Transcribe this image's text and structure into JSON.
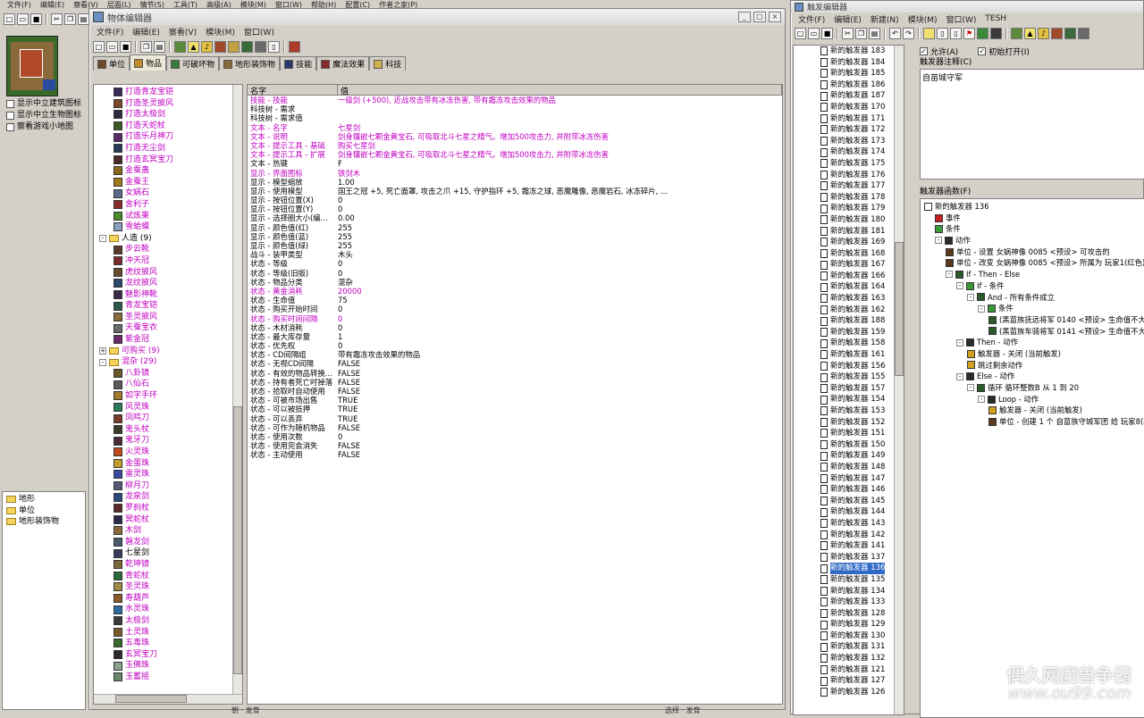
{
  "main_menu": [
    "文件(F)",
    "编辑(E)",
    "察看(V)",
    "层面(L)",
    "情节(S)",
    "工具(T)",
    "高级(A)",
    "模块(M)",
    "窗口(W)",
    "帮助(H)",
    "配置(C)",
    "作者之家(P)"
  ],
  "minimap_options": [
    "显示中立建筑图标",
    "显示中立生物图标",
    "察看游戏小地图"
  ],
  "palette_tree": [
    "地形",
    "单位",
    "地形装饰物"
  ],
  "object_editor": {
    "title": "物体编辑器",
    "menu": [
      "文件(F)",
      "编辑(E)",
      "察看(V)",
      "模块(M)",
      "窗口(W)"
    ],
    "tabs": [
      {
        "label": "单位",
        "icon": "unit-icon"
      },
      {
        "label": "物品",
        "icon": "item-icon"
      },
      {
        "label": "可破坏物",
        "icon": "destructible-icon"
      },
      {
        "label": "地形装饰物",
        "icon": "doodad-icon"
      },
      {
        "label": "技能",
        "icon": "ability-icon"
      },
      {
        "label": "魔法效果",
        "icon": "buff-icon"
      },
      {
        "label": "科技",
        "icon": "upgrade-icon"
      }
    ],
    "tree_rows": [
      {
        "t": "item",
        "label": "打造青龙宝铠",
        "color": "mag",
        "ic": "#3a2a5a"
      },
      {
        "t": "item",
        "label": "打造圣灵披风",
        "color": "mag",
        "ic": "#7a4a2a"
      },
      {
        "t": "item",
        "label": "打造太极剑",
        "color": "mag",
        "ic": "#2a2a3a"
      },
      {
        "t": "item",
        "label": "打造天蛇杖",
        "color": "mag",
        "ic": "#3a5a2a"
      },
      {
        "t": "item",
        "label": "打造乐月神刀",
        "color": "mag",
        "ic": "#5a2a6a"
      },
      {
        "t": "item",
        "label": "打造无尘剑",
        "color": "mag",
        "ic": "#2a3a5a"
      },
      {
        "t": "item",
        "label": "打造玄冥宝刀",
        "color": "mag",
        "ic": "#4a2a2a"
      },
      {
        "t": "item",
        "label": "金蚕蛊",
        "color": "mag",
        "ic": "#8a6a1a"
      },
      {
        "t": "item",
        "label": "金蚕王",
        "color": "mag",
        "ic": "#a07a1a"
      },
      {
        "t": "item",
        "label": "女娲石",
        "color": "mag",
        "ic": "#5a6a8a"
      },
      {
        "t": "item",
        "label": "舍利子",
        "color": "mag",
        "ic": "#8a2a2a"
      },
      {
        "t": "item",
        "label": "试炼果",
        "color": "mag",
        "ic": "#4a8a2a"
      },
      {
        "t": "item",
        "label": "雪蛤蟆",
        "color": "mag",
        "ic": "#8aa0c0"
      },
      {
        "t": "folder",
        "label": "人造 (9)",
        "color": "",
        "pm": "-"
      },
      {
        "t": "item",
        "label": "步云靴",
        "color": "mag",
        "ic": "#5a3a2a"
      },
      {
        "t": "item",
        "label": "冲天冠",
        "color": "mag",
        "ic": "#7a2a2a"
      },
      {
        "t": "item",
        "label": "虎纹披风",
        "color": "mag",
        "ic": "#6a4a2a"
      },
      {
        "t": "item",
        "label": "龙纹披风",
        "color": "mag",
        "ic": "#2a4a6a"
      },
      {
        "t": "item",
        "label": "魅影神靴",
        "color": "mag",
        "ic": "#3a2a4a"
      },
      {
        "t": "item",
        "label": "青龙宝铠",
        "color": "mag",
        "ic": "#2a5a4a"
      },
      {
        "t": "item",
        "label": "圣灵披风",
        "color": "mag",
        "ic": "#8a6a3a"
      },
      {
        "t": "item",
        "label": "天蚕宝衣",
        "color": "mag",
        "ic": "#6a6a6a"
      },
      {
        "t": "item",
        "label": "紫金冠",
        "color": "mag",
        "ic": "#6a2a6a"
      },
      {
        "t": "folder",
        "label": "可购买 (9)",
        "color": "mag",
        "pm": "+"
      },
      {
        "t": "folder",
        "label": "混杂 (29)",
        "color": "mag",
        "pm": "-"
      },
      {
        "t": "item",
        "label": "八卦镜",
        "color": "mag",
        "ic": "#6a5a2a"
      },
      {
        "t": "item",
        "label": "八仙石",
        "color": "mag",
        "ic": "#5a5a5a"
      },
      {
        "t": "item",
        "label": "如字手环",
        "color": "mag",
        "ic": "#a07a2a"
      },
      {
        "t": "item",
        "label": "风灵珠",
        "color": "mag",
        "ic": "#2a7a5a"
      },
      {
        "t": "item",
        "label": "凤鸣刀",
        "color": "mag",
        "ic": "#7a3a2a"
      },
      {
        "t": "item",
        "label": "鬼头杖",
        "color": "mag",
        "ic": "#3a3a2a"
      },
      {
        "t": "item",
        "label": "鬼牙刀",
        "color": "mag",
        "ic": "#4a2a3a"
      },
      {
        "t": "item",
        "label": "火灵珠",
        "color": "mag",
        "ic": "#c04a1a"
      },
      {
        "t": "item",
        "label": "金蛋珠",
        "color": "mag",
        "ic": "#c0a02a"
      },
      {
        "t": "item",
        "label": "雷灵珠",
        "color": "mag",
        "ic": "#3a4aa0"
      },
      {
        "t": "item",
        "label": "柳月刀",
        "color": "mag",
        "ic": "#5a5a7a"
      },
      {
        "t": "item",
        "label": "龙泉剑",
        "color": "mag",
        "ic": "#2a4a7a"
      },
      {
        "t": "item",
        "label": "罗刹杖",
        "color": "mag",
        "ic": "#5a2a2a"
      },
      {
        "t": "item",
        "label": "冥蛇杖",
        "color": "mag",
        "ic": "#2a2a4a"
      },
      {
        "t": "item",
        "label": "木剑",
        "color": "mag",
        "ic": "#8a6a3a"
      },
      {
        "t": "item",
        "label": "磐龙剑",
        "color": "mag",
        "ic": "#4a5a6a"
      },
      {
        "t": "item",
        "label": "七星剑",
        "color": "",
        "ic": "#3a3a5a"
      },
      {
        "t": "item",
        "label": "乾坤镜",
        "color": "mag",
        "ic": "#7a6a3a"
      },
      {
        "t": "item",
        "label": "青蛇杖",
        "color": "mag",
        "ic": "#2a6a3a"
      },
      {
        "t": "item",
        "label": "圣灵珠",
        "color": "mag",
        "ic": "#a08a4a"
      },
      {
        "t": "item",
        "label": "寿葫芦",
        "color": "mag",
        "ic": "#8a5a2a"
      },
      {
        "t": "item",
        "label": "水灵珠",
        "color": "mag",
        "ic": "#2a6aa0"
      },
      {
        "t": "item",
        "label": "太极剑",
        "color": "mag",
        "ic": "#3a3a3a"
      },
      {
        "t": "item",
        "label": "土灵珠",
        "color": "mag",
        "ic": "#7a5a2a"
      },
      {
        "t": "item",
        "label": "五毒珠",
        "color": "mag",
        "ic": "#3a6a2a"
      },
      {
        "t": "item",
        "label": "玄冥宝刀",
        "color": "mag",
        "ic": "#2a2a2a"
      },
      {
        "t": "item",
        "label": "玉佛珠",
        "color": "mag",
        "ic": "#8aa08a"
      },
      {
        "t": "item",
        "label": "玉蓄摇",
        "color": "mag",
        "ic": "#6a8a6a"
      }
    ],
    "prop_header": [
      "名字",
      "值"
    ],
    "props": [
      {
        "k": "技能 - 技能",
        "v": "一级剑 (+500), 近战攻击带有冰冻伤害, 带有霜冻攻击效果的物品",
        "m": true
      },
      {
        "k": "科技树 - 需求",
        "v": "",
        "m": false
      },
      {
        "k": "科技树 - 需求值",
        "v": "",
        "m": false
      },
      {
        "k": "文本 - 名字",
        "v": "七星剑",
        "m": true
      },
      {
        "k": "文本 - 说明",
        "v": "剑身镶嵌七颗金黄宝石, 可吸取北斗七星之精气。增加500攻击力, 并附带冰冻伤害",
        "m": true
      },
      {
        "k": "文本 - 提示工具 - 基础",
        "v": "购买七星剑",
        "m": true
      },
      {
        "k": "文本 - 提示工具 - 扩展",
        "v": "剑身镶嵌七颗金黄宝石, 可吸取北斗七星之精气。增加500攻击力, 并附带冰冻伤害",
        "m": true
      },
      {
        "k": "文本 - 热键",
        "v": "F",
        "m": false
      },
      {
        "k": "显示 - 界面图标",
        "v": "铁剑木",
        "m": true
      },
      {
        "k": "显示 - 模型缩放",
        "v": "1.00",
        "m": false
      },
      {
        "k": "显示 - 使用模型",
        "v": "国王之冠 +5, 死亡面罩, 攻击之爪 +15, 守护指环 +5, 霜冻之球, 恶魔雕像, 恶魔岩石, 冰冻碎片, ...",
        "m": false
      },
      {
        "k": "显示 - 按钮位置(X)",
        "v": "0",
        "m": false
      },
      {
        "k": "显示 - 按钮位置(Y)",
        "v": "0",
        "m": false
      },
      {
        "k": "显示 - 选择圈大小(编...",
        "v": "0.00",
        "m": false
      },
      {
        "k": "显示 - 颜色值(红)",
        "v": "255",
        "m": false
      },
      {
        "k": "显示 - 颜色值(蓝)",
        "v": "255",
        "m": false
      },
      {
        "k": "显示 - 颜色值(绿)",
        "v": "255",
        "m": false
      },
      {
        "k": "战斗 - 装甲类型",
        "v": "木头",
        "m": false
      },
      {
        "k": "状态 - 等级",
        "v": "0",
        "m": false
      },
      {
        "k": "状态 - 等级(旧版)",
        "v": "0",
        "m": false
      },
      {
        "k": "状态 - 物品分类",
        "v": "混杂",
        "m": false
      },
      {
        "k": "状态 - 黄金消耗",
        "v": "20000",
        "m": true
      },
      {
        "k": "状态 - 生命值",
        "v": "75",
        "m": false
      },
      {
        "k": "状态 - 购买开始时间",
        "v": "0",
        "m": false
      },
      {
        "k": "状态 - 购买时间间隔",
        "v": "0",
        "m": true
      },
      {
        "k": "状态 - 木材消耗",
        "v": "0",
        "m": false
      },
      {
        "k": "状态 - 最大库存量",
        "v": "1",
        "m": false
      },
      {
        "k": "状态 - 优先权",
        "v": "0",
        "m": false
      },
      {
        "k": "状态 - CD间隔组",
        "v": "带有霜冻攻击效果的物品",
        "m": false
      },
      {
        "k": "状态 - 无视CD间隔",
        "v": "FALSE",
        "m": false
      },
      {
        "k": "状态 - 有效的物品转换...",
        "v": "FALSE",
        "m": false
      },
      {
        "k": "状态 - 持有者死亡时掉落",
        "v": "FALSE",
        "m": false
      },
      {
        "k": "状态 - 拾取时自动使用",
        "v": "FALSE",
        "m": false
      },
      {
        "k": "状态 - 可被市场出售",
        "v": "TRUE",
        "m": false
      },
      {
        "k": "状态 - 可以被抵押",
        "v": "TRUE",
        "m": false
      },
      {
        "k": "状态 - 可以丢弃",
        "v": "TRUE",
        "m": false
      },
      {
        "k": "状态 - 可作为随机物品",
        "v": "FALSE",
        "m": false
      },
      {
        "k": "状态 - 使用次数",
        "v": "0",
        "m": false
      },
      {
        "k": "状态 - 使用完会消失",
        "v": "FALSE",
        "m": false
      },
      {
        "k": "状态 - 主动使用",
        "v": "FALSE",
        "m": false
      }
    ]
  },
  "trigger_editor": {
    "title": "触发编辑器",
    "menu": [
      "文件(F)",
      "编辑(E)",
      "新建(N)",
      "模块(M)",
      "窗口(W)",
      "TESH"
    ],
    "triggers": [
      "新的触发器 183",
      "新的触发器 184",
      "新的触发器 185",
      "新的触发器 186",
      "新的触发器 187",
      "新的触发器 170",
      "新的触发器 171",
      "新的触发器 172",
      "新的触发器 173",
      "新的触发器 174",
      "新的触发器 175",
      "新的触发器 176",
      "新的触发器 177",
      "新的触发器 178",
      "新的触发器 179",
      "新的触发器 180",
      "新的触发器 181",
      "新的触发器 169",
      "新的触发器 168",
      "新的触发器 167",
      "新的触发器 166",
      "新的触发器 164",
      "新的触发器 163",
      "新的触发器 162",
      "新的触发器 188",
      "新的触发器 159",
      "新的触发器 158",
      "新的触发器 161",
      "新的触发器 156",
      "新的触发器 155",
      "新的触发器 157",
      "新的触发器 154",
      "新的触发器 153",
      "新的触发器 152",
      "新的触发器 151",
      "新的触发器 150",
      "新的触发器 149",
      "新的触发器 148",
      "新的触发器 147",
      "新的触发器 146",
      "新的触发器 145",
      "新的触发器 144",
      "新的触发器 143",
      "新的触发器 142",
      "新的触发器 141",
      "新的触发器 137",
      "新的触发器 136",
      "新的触发器 135",
      "新的触发器 134",
      "新的触发器 133",
      "新的触发器 128",
      "新的触发器 129",
      "新的触发器 130",
      "新的触发器 131",
      "新的触发器 132",
      "新的触发器 121",
      "新的触发器 127",
      "新的触发器 126"
    ],
    "selected_trigger": "新的触发器 136",
    "allow_label": "允许(A)",
    "initial_open_label": "初始打开(I)",
    "comment_label": "触发器注释(C)",
    "comment_text": "自苗城守军",
    "functions_label": "触发器函数(F)",
    "functions": [
      {
        "d": 0,
        "pm": "",
        "ic": "page",
        "t": "新的触发器 136"
      },
      {
        "d": 1,
        "pm": "",
        "ic": "flag",
        "t": "事件"
      },
      {
        "d": 1,
        "pm": "",
        "ic": "cond",
        "t": "条件"
      },
      {
        "d": 1,
        "pm": "-",
        "ic": "action",
        "t": "动作"
      },
      {
        "d": 2,
        "pm": "",
        "ic": "unit",
        "t": "单位 - 设置 女娲神像 0085 <预设> 可攻击的"
      },
      {
        "d": 2,
        "pm": "",
        "ic": "unit",
        "t": "单位 - 改变 女娲神像 0085 <预设> 所属为 玩家1(红色) 并 改..."
      },
      {
        "d": 2,
        "pm": "-",
        "ic": "green",
        "t": "If - Then - Else"
      },
      {
        "d": 3,
        "pm": "-",
        "ic": "cond",
        "t": "If - 条件"
      },
      {
        "d": 4,
        "pm": "-",
        "ic": "green",
        "t": "And - 所有条件成立"
      },
      {
        "d": 5,
        "pm": "-",
        "ic": "cond",
        "t": "条件"
      },
      {
        "d": 6,
        "pm": "",
        "ic": "green",
        "t": "(黑苗族抚远将军 0140 <预设> 生命值不大于 0.00)"
      },
      {
        "d": 6,
        "pm": "",
        "ic": "green",
        "t": "(黑苗族车骑将军 0141 <预设> 生命值不大于 0.00)"
      },
      {
        "d": 3,
        "pm": "-",
        "ic": "action",
        "t": "Then - 动作"
      },
      {
        "d": 4,
        "pm": "",
        "ic": "trig",
        "t": "触发器 - 关闭 (当前触发)"
      },
      {
        "d": 4,
        "pm": "",
        "ic": "trig",
        "t": "跳过剩余动作"
      },
      {
        "d": 3,
        "pm": "-",
        "ic": "action",
        "t": "Else - 动作"
      },
      {
        "d": 4,
        "pm": "-",
        "ic": "green",
        "t": "循环 循环整数B 从 1 到 20"
      },
      {
        "d": 5,
        "pm": "-",
        "ic": "action",
        "t": "Loop - 动作"
      },
      {
        "d": 6,
        "pm": "",
        "ic": "trig",
        "t": "触发器 - 关闭 (当前触发)"
      },
      {
        "d": 6,
        "pm": "",
        "ic": "unit",
        "t": "单位 - 创建 1 个 自苗族守城军团 给 玩家8(粉色) ..."
      }
    ]
  },
  "status": {
    "left": "朝 · 发育",
    "mid": "选择 · 发育"
  },
  "watermark": {
    "line1": "偶久网魔兽争霸",
    "line2": "www.ou99.com"
  }
}
